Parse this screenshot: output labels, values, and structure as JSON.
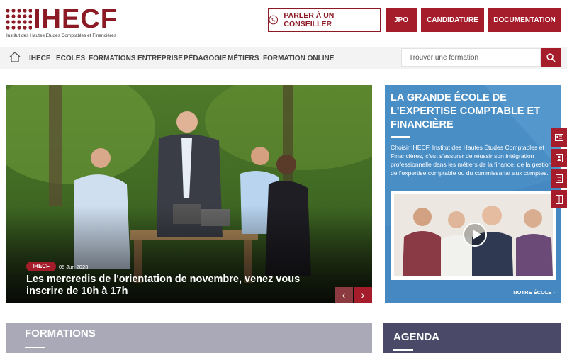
{
  "logo": {
    "text": "IHECF",
    "subtitle": "Institut des Hautes Études Comptables et Financières"
  },
  "header": {
    "cta_advisor": "PARLER À UN CONSEILLER",
    "cta_jpo": "JPO",
    "cta_candidature": "CANDIDATURE",
    "cta_documentation": "DOCUMENTATION"
  },
  "nav": {
    "items": [
      "IHECF",
      "ECOLES",
      "FORMATIONS",
      "ENTREPRISE",
      "PÉDAGOGIE",
      "MÉTIERS",
      "FORMATION ONLINE"
    ]
  },
  "search": {
    "placeholder": "Trouver une formation"
  },
  "hero": {
    "badge": "IHECF",
    "date": "05 Jun 2023",
    "title": "Les mercredis de l'orientation de novembre, venez vous inscrire de 10h à 17h"
  },
  "promo": {
    "title": "LA GRANDE ÉCOLE DE L'EXPERTISE COMPTABLE ET FINANCIÈRE",
    "text": "Choisir IHECF, Institut des Hautes Études Comptables et Financières, c'est s'assurer de réussir son intégration professionnelle dans les métiers de la finance, de la gestion, de l'expertise comptable ou du commissariat aux comptes.",
    "link": "NOTRE ÉCOLE"
  },
  "sections": {
    "formations": "FORMATIONS",
    "agenda": "AGENDA"
  },
  "colors": {
    "brand": "#a51c2a",
    "promo_blue": "#4a8ec6",
    "agenda_bg": "#4a4a68",
    "formations_bg": "#aaa9b8"
  }
}
